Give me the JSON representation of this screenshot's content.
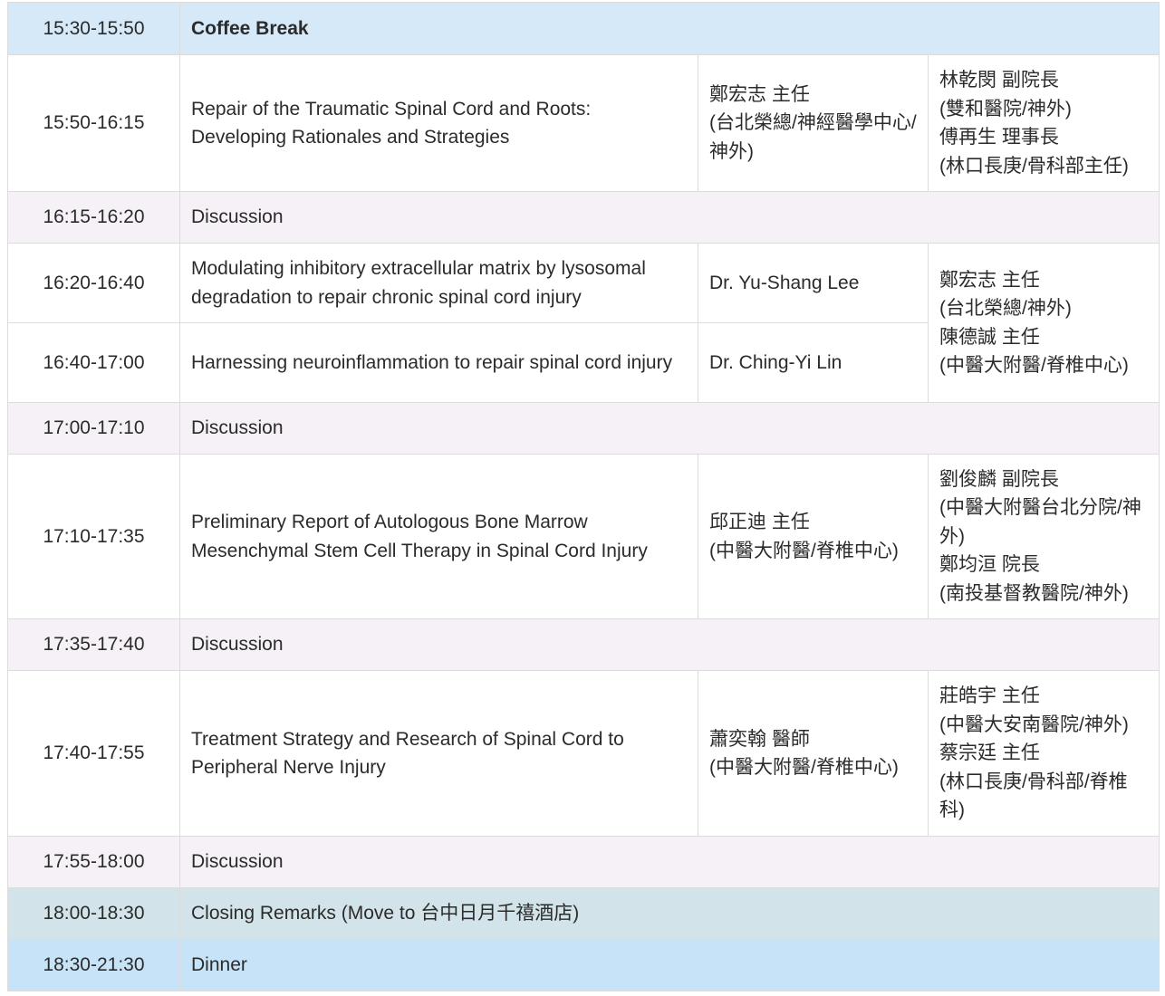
{
  "rows": [
    {
      "time": "15:30-15:50",
      "title": "Coffee Break"
    },
    {
      "time": "15:50-16:15",
      "title": "Repair of the Traumatic Spinal Cord and Roots: Developing Rationales and Strategies",
      "speaker": [
        "鄭宏志 主任",
        "(台北榮總/神經醫學中心/神外)"
      ],
      "moderator": [
        "林乾閔 副院長",
        "(雙和醫院/神外)",
        "傅再生 理事長",
        "(林口長庚/骨科部主任)"
      ]
    },
    {
      "time": "16:15-16:20",
      "title": "Discussion"
    },
    {
      "time": "16:20-16:40",
      "title": "Modulating inhibitory extracellular matrix by lysosomal degradation to repair chronic spinal cord injury",
      "speaker": [
        "Dr. Yu-Shang Lee"
      ],
      "moderator": [
        "鄭宏志 主任",
        "(台北榮總/神外)",
        "陳德誠 主任",
        "(中醫大附醫/脊椎中心)"
      ]
    },
    {
      "time": "16:40-17:00",
      "title": "Harnessing neuroinflammation to repair spinal cord injury",
      "speaker": [
        "Dr. Ching-Yi Lin"
      ]
    },
    {
      "time": "17:00-17:10",
      "title": "Discussion"
    },
    {
      "time": "17:10-17:35",
      "title": "Preliminary Report of Autologous Bone Marrow Mesenchymal Stem Cell Therapy in Spinal Cord Injury",
      "speaker": [
        "邱正迪 主任",
        "(中醫大附醫/脊椎中心)"
      ],
      "moderator": [
        "劉俊麟 副院長",
        "(中醫大附醫台北分院/神外)",
        "鄭均洹 院長",
        "(南投基督教醫院/神外)"
      ]
    },
    {
      "time": "17:35-17:40",
      "title": "Discussion"
    },
    {
      "time": "17:40-17:55",
      "title": "Treatment Strategy and Research of Spinal Cord to Peripheral Nerve Injury",
      "speaker": [
        "蕭奕翰 醫師",
        "(中醫大附醫/脊椎中心)"
      ],
      "moderator": [
        "莊皓宇 主任",
        "(中醫大安南醫院/神外)",
        "蔡宗廷 主任",
        "(林口長庚/骨科部/脊椎科)"
      ]
    },
    {
      "time": "17:55-18:00",
      "title": "Discussion"
    },
    {
      "time": "18:00-18:30",
      "title": "Closing Remarks (Move to 台中日月千禧酒店)"
    },
    {
      "time": "18:30-21:30",
      "title": "Dinner"
    }
  ],
  "colors": {
    "break": "#d5e9f8",
    "discussion": "#f6f1f6",
    "closing": "#d2e4e9",
    "dinner": "#c7e3f7",
    "border": "#dcdcdc"
  }
}
